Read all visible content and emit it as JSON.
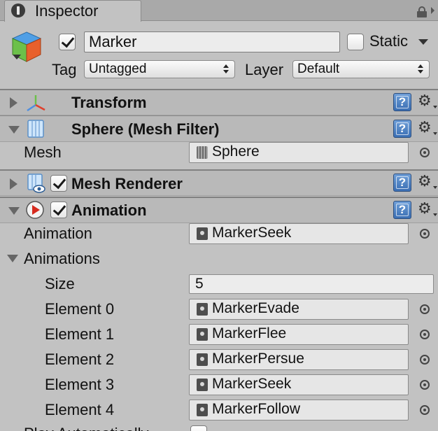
{
  "tab": {
    "title": "Inspector"
  },
  "header": {
    "active": true,
    "name": "Marker",
    "static_label": "Static",
    "static_checked": false,
    "tag_label": "Tag",
    "tag_value": "Untagged",
    "layer_label": "Layer",
    "layer_value": "Default"
  },
  "components": {
    "transform": {
      "title": "Transform"
    },
    "mesh_filter": {
      "title": "Sphere (Mesh Filter)",
      "mesh_label": "Mesh",
      "mesh_value": "Sphere"
    },
    "mesh_renderer": {
      "title": "Mesh Renderer",
      "enabled": true
    },
    "animation": {
      "title": "Animation",
      "enabled": true,
      "animation_label": "Animation",
      "animation_value": "MarkerSeek",
      "animations_label": "Animations",
      "size_label": "Size",
      "size_value": "5",
      "elements": [
        {
          "label": "Element 0",
          "value": "MarkerEvade"
        },
        {
          "label": "Element 1",
          "value": "MarkerFlee"
        },
        {
          "label": "Element 2",
          "value": "MarkerPersue"
        },
        {
          "label": "Element 3",
          "value": "MarkerSeek"
        },
        {
          "label": "Element 4",
          "value": "MarkerFollow"
        }
      ],
      "play_automatically_label": "Play Automatically"
    }
  },
  "colors": {
    "panel_bg": "#c2c2c2",
    "header_bg": "#b9b9b9",
    "help_blue": "#3a6eb3"
  }
}
